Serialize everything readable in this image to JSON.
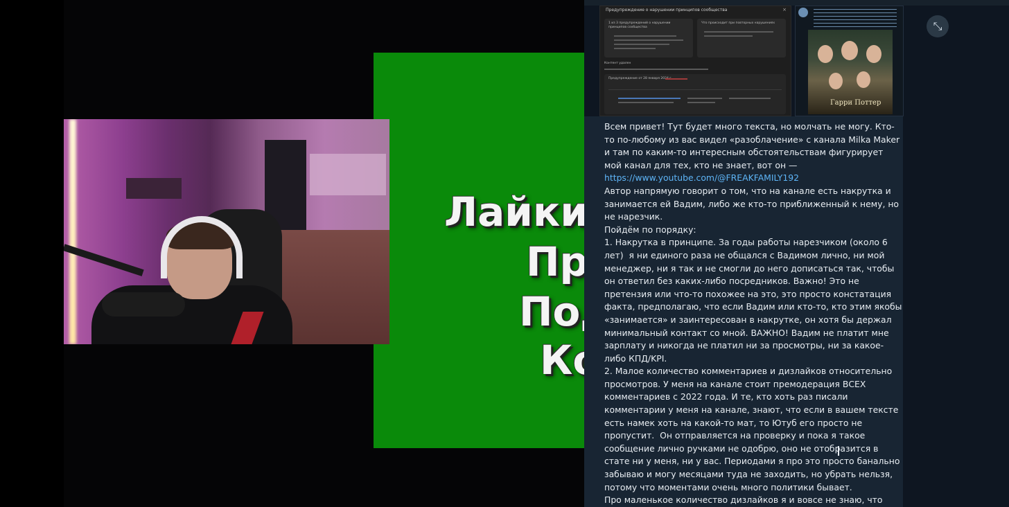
{
  "slide": {
    "lines": [
      "Лайки",
      "Пр",
      "Под",
      "Ко"
    ]
  },
  "telegram": {
    "screenshot_card": {
      "title": "Предупреждение о нарушении принципов сообщества",
      "close_label": "×",
      "block1_title": "1 из 3 предупреждений о нарушении принципов сообщества",
      "block2_title": "Что происходит при повторных нарушениях",
      "section_label": "Контент удален",
      "warning_label": "Предупреждение от 28 января 2024 г."
    },
    "expand_icon": "⤡",
    "message": {
      "paragraph1": "Всем привет! Тут будет много текста, но молчать не могу. Кто-то по-любому из вас видел «разоблачение» с канала Milka Maker и там по каким-то интересным обстоятельствам фигурирует мой канал для тех, кто не знает, вот он —",
      "link": "https://www.youtube.com/@FREAKFAMILY192",
      "paragraph2": "Автор напрямую говорит о том, что на канале есть накрутка и занимается ей Вадим, либо же кто-то приближенный к нему, но не нарезчик.\nПойдём по порядку:\n1. Накрутка в принципе. За годы работы нарезчиком (около 6 лет)  я ни единого раза не общался с Вадимом лично, ни мой менеджер, ни я так и не смогли до него дописаться так, чтобы он ответил без каких-либо посредников. Важно! Это не претензия или что-то похожее на это, это просто констатация факта, предполагаю, что если Вадим или кто-то, кто этим якобы «занимается» и заинтересован в накрутке, он хотя бы держал минимальный контакт со мной. ВАЖНО! Вадим не платит мне зарплату и никогда не платил ни за просмотры, ни за какое-либо КПД/KPI.\n2. Малое количество комментариев и дизлайков относительно просмотров. У меня на канале стоит премодерация ВСЕХ комментариев с 2022 года. И те, кто хоть раз писали комментарии у меня на канале, знают, что если в вашем тексте есть намек хоть на какой-то мат, то Ютуб его просто не пропустит.  Он отправляется на проверку и пока я такое сообщение лично ручками не одобрю, оно не отобразится в стате ни у меня, ни у вас. Периодами я про это просто банально забываю и могу месяцами туда не заходить, но убрать нельзя, потому что моментами очень много политики бывает.\nПро маленькое количество дизлайков я и вовсе не знаю, что"
    },
    "poster": {
      "title": "Гарри Поттер"
    }
  }
}
